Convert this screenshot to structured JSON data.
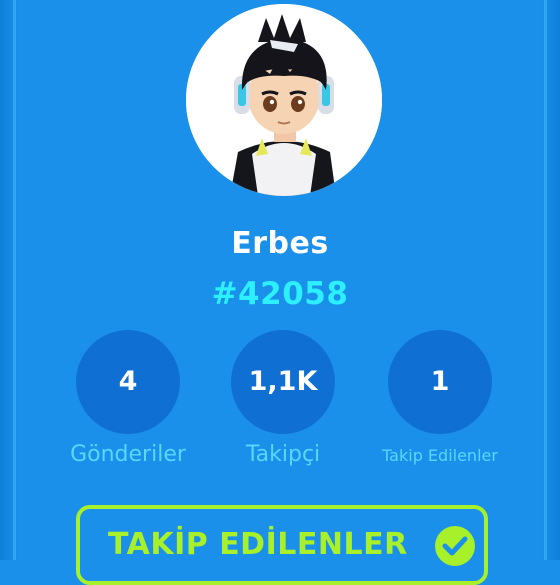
{
  "profile": {
    "username": "Erbes",
    "user_id": "#42058",
    "avatar_icon": "avatar-character-icon"
  },
  "stats": [
    {
      "value": "4",
      "label": "Gönderiler"
    },
    {
      "value": "1,1K",
      "label": "Takipçi"
    },
    {
      "value": "1",
      "label": "Takip Edilenler"
    }
  ],
  "follow_button": {
    "label": "TAKİP EDİLENLER",
    "icon": "check-circle-icon"
  },
  "colors": {
    "background": "#1a90ea",
    "stat_circle": "#0f6fd2",
    "id_text": "#2cf0ff",
    "stat_label": "#5ad6ff",
    "accent_green": "#a8f02a"
  }
}
